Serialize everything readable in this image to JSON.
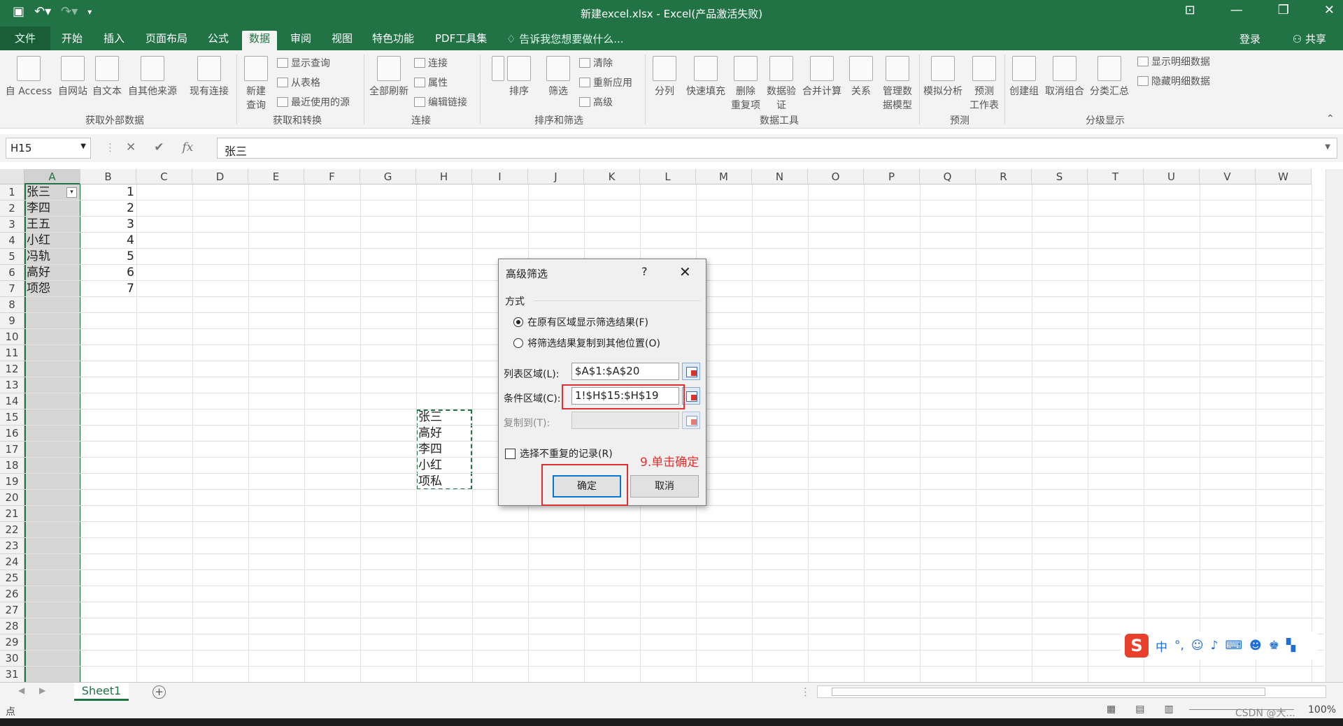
{
  "window": {
    "title": "新建excel.xlsx - Excel(产品激活失败)",
    "qat": [
      "save-icon",
      "undo-icon",
      "redo-icon",
      "customize-icon"
    ],
    "controls": [
      "ribbon-display-icon",
      "minimize-icon",
      "restore-icon",
      "close-icon"
    ]
  },
  "tabs": {
    "file": "文件",
    "items": [
      "开始",
      "插入",
      "页面布局",
      "公式",
      "数据",
      "审阅",
      "视图",
      "特色功能",
      "PDF工具集"
    ],
    "active": "数据",
    "tellme": "告诉我您想要做什么...",
    "login": "登录",
    "share": "共享"
  },
  "ribbon": {
    "external": {
      "access": "自 Access",
      "web": "自网站",
      "text": "自文本",
      "other": "自其他来源",
      "existing": "现有连接",
      "group": "获取外部数据"
    },
    "transform": {
      "newquery_1": "新建",
      "newquery_2": "查询",
      "show_query": "显示查询",
      "from_table": "从表格",
      "recent_sources": "最近使用的源",
      "group": "获取和转换"
    },
    "connections": {
      "refresh_all": "全部刷新",
      "connections": "连接",
      "properties": "属性",
      "edit_links": "编辑链接",
      "group": "连接"
    },
    "sortfilter": {
      "sort": "排序",
      "filter": "筛选",
      "clear": "清除",
      "reapply": "重新应用",
      "advanced": "高级",
      "group": "排序和筛选"
    },
    "datatools": {
      "split": "分列",
      "flash_fill": "快速填充",
      "remove_dup_1": "删除",
      "remove_dup_2": "重复项",
      "validate_1": "数据验",
      "validate_2": "证",
      "consolidate": "合并计算",
      "relations": "关系",
      "model_1": "管理数",
      "model_2": "据模型",
      "group": "数据工具"
    },
    "forecast": {
      "whatif": "模拟分析",
      "sheet_1": "预测",
      "sheet_2": "工作表",
      "group": "预测"
    },
    "outline": {
      "group_btn": "创建组",
      "ungroup": "取消组合",
      "subtotal": "分类汇总",
      "show_detail": "显示明细数据",
      "hide_detail": "隐藏明细数据",
      "group": "分级显示"
    }
  },
  "formula_bar": {
    "name_box": "H15",
    "formula": "张三"
  },
  "grid": {
    "columns": [
      "A",
      "B",
      "C",
      "D",
      "E",
      "F",
      "G",
      "H",
      "I",
      "J",
      "K",
      "L",
      "M",
      "N",
      "O",
      "P",
      "Q",
      "R",
      "S",
      "T",
      "U",
      "V",
      "W"
    ],
    "rows": [
      "1",
      "2",
      "3",
      "4",
      "5",
      "6",
      "7",
      "8",
      "9",
      "10",
      "11",
      "12",
      "13",
      "14",
      "15",
      "16",
      "17",
      "18",
      "19",
      "20",
      "21",
      "22",
      "23",
      "24",
      "25",
      "26",
      "27",
      "28",
      "29",
      "30",
      "31"
    ],
    "col_a": [
      "张三",
      "李四",
      "王五",
      "小红",
      "冯轨",
      "高好",
      "项怨"
    ],
    "col_b": [
      "1",
      "2",
      "3",
      "4",
      "5",
      "6",
      "7"
    ],
    "col_h": [
      "张三",
      "高好",
      "李四",
      "小红",
      "项私"
    ]
  },
  "sheet": {
    "tab": "Sheet1",
    "status": "点",
    "zoom": "100%",
    "watermark": "CSDN @大..."
  },
  "ime": {
    "logo": "S",
    "mode": "中",
    "punct": "°,"
  },
  "dialog": {
    "title": "高级筛选",
    "help": "?",
    "close": "✕",
    "section": "方式",
    "radio1": "在原有区域显示筛选结果(F)",
    "radio2": "将筛选结果复制到其他位置(O)",
    "list_label": "列表区域(L):",
    "list_value": "$A$1:$A$20",
    "criteria_label": "条件区域(C):",
    "criteria_value": "1!$H$15:$H$19",
    "copy_label": "复制到(T):",
    "copy_value": "",
    "unique_label": "选择不重复的记录(R)",
    "ok": "确定",
    "cancel": "取消"
  },
  "annotation": "9.单击确定"
}
